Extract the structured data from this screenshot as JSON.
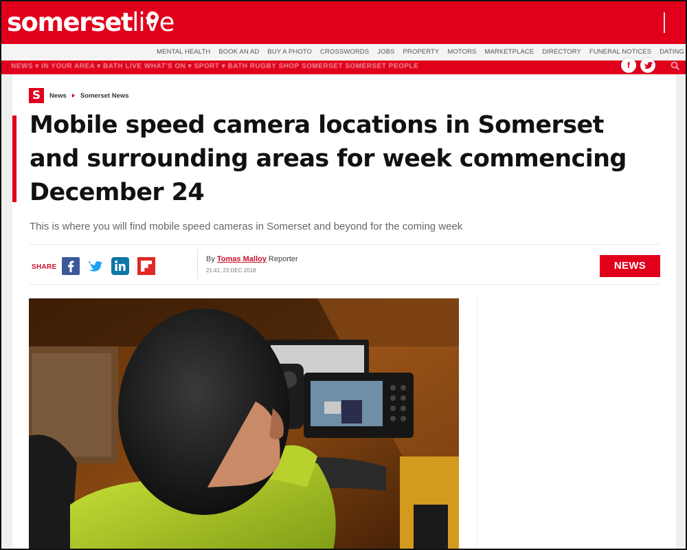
{
  "brand": {
    "logo_main": "somerset",
    "logo_accent": "live"
  },
  "services_nav": [
    "MENTAL HEALTH",
    "BOOK AN AD",
    "BUY A PHOTO",
    "CROSSWORDS",
    "JOBS",
    "PROPERTY",
    "MOTORS",
    "MARKETPLACE",
    "DIRECTORY",
    "FUNERAL NOTICES",
    "DATING"
  ],
  "main_nav": {
    "blurred_items": "NEWS ▾    IN YOUR AREA ▾    BATH LIVE    WHAT'S ON ▾    SPORT ▾    BATH RUGBY    SHOP SOMERSET    SOMERSET PEOPLE"
  },
  "social_top": {
    "facebook": "f",
    "twitter": "t"
  },
  "breadcrumb": {
    "logo": "S",
    "items": [
      "News",
      "Somerset News"
    ]
  },
  "article": {
    "headline": "Mobile speed camera locations in Somerset and surrounding areas for week commencing December 24",
    "standfirst": "This is where you will find mobile speed cameras in Somerset and beyond for the coming week",
    "share_label": "SHARE",
    "byline_prefix": "By",
    "author": "Tomas Malloy",
    "author_role": "Reporter",
    "timestamp": "21:41, 23 DEC 2018",
    "section_tag": "NEWS"
  },
  "share_buttons": [
    "facebook",
    "twitter",
    "linkedin",
    "flipboard"
  ],
  "colors": {
    "brand_red": "#e0001b",
    "link_red": "#c8102e",
    "facebook": "#3b5998",
    "twitter": "#1da1f2",
    "linkedin": "#0e76a8",
    "flipboard": "#e12828"
  }
}
